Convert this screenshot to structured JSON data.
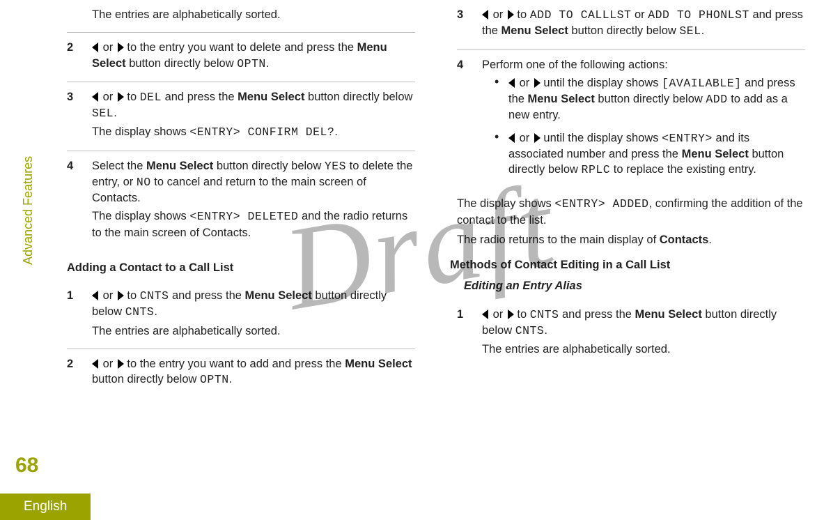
{
  "watermark": "Draft",
  "sideLabel": "Advanced Features",
  "pageNumber": "68",
  "language": "English",
  "ui": {
    "or": " or ",
    "to": " to ",
    "menuSelect": "Menu Select",
    "contacts": "Contacts"
  },
  "col1": {
    "intro": "The entries are alphabetically sorted.",
    "step2": {
      "num": "2",
      "t1": " to the entry you want to delete and press the ",
      "t2": " button directly below ",
      "code1": "OPTN",
      "t3": "."
    },
    "step3": {
      "num": "3",
      "code1": "DEL",
      "t1": " and press the ",
      "t2": " button directly below ",
      "code2": "SEL",
      "t3": ".",
      "t4": "The display shows ",
      "code3": "<ENTRY> CONFIRM DEL?",
      "t5": "."
    },
    "step4": {
      "num": "4",
      "t1": "Select the ",
      "t2": " button directly below ",
      "code1": "YES",
      "t3": " to delete the entry, or ",
      "code2": "NO",
      "t4": " to cancel and return to the main screen of Contacts.",
      "t5": "The display shows ",
      "code3": "<ENTRY> DELETED",
      "t6": " and the radio returns to the main screen of Contacts."
    },
    "heading": "Adding a Contact to a Call List",
    "bstep1": {
      "num": "1",
      "code1": "CNTS",
      "t1": " and press the ",
      "t2": " button directly below ",
      "code2": "CNTS",
      "t3": ".",
      "t4": "The entries are alphabetically sorted."
    },
    "bstep2": {
      "num": "2",
      "t1": " to the entry you want to add and press the ",
      "t2": " button directly below ",
      "code1": "OPTN",
      "t3": "."
    }
  },
  "col2": {
    "step3": {
      "num": "3",
      "code1": "ADD TO CALLLST",
      "t1": " or ",
      "code2": "ADD TO PHONLST",
      "t2": " and press the ",
      "t3": " button directly below ",
      "code3": "SEL",
      "t4": "."
    },
    "step4": {
      "num": "4",
      "t1": "Perform one of the following actions:",
      "b1": {
        "t1": " until the display shows ",
        "code1": "[AVAILABLE]",
        "t2": " and press the ",
        "t3": " button directly below ",
        "code2": "ADD",
        "t4": " to add as a new entry."
      },
      "b2": {
        "t1": " until the display shows ",
        "code1": "<ENTRY>",
        "t2": " and its associated number and press the ",
        "t3": " button directly below ",
        "code2": "RPLC",
        "t4": " to replace the existing entry."
      },
      "t2": "The display shows ",
      "code1": "<ENTRY> ADDED",
      "t3": ", confirming the addition of the contact to the list.",
      "t4": "The radio returns to the main display of "
    },
    "heading": "Methods of Contact Editing in a Call List",
    "subheading": "Editing an Entry Alias",
    "cstep1": {
      "num": "1",
      "code1": "CNTS",
      "t1": " and press the ",
      "t2": " button directly below ",
      "code2": "CNTS",
      "t3": ".",
      "t4": "The entries are alphabetically sorted."
    }
  }
}
